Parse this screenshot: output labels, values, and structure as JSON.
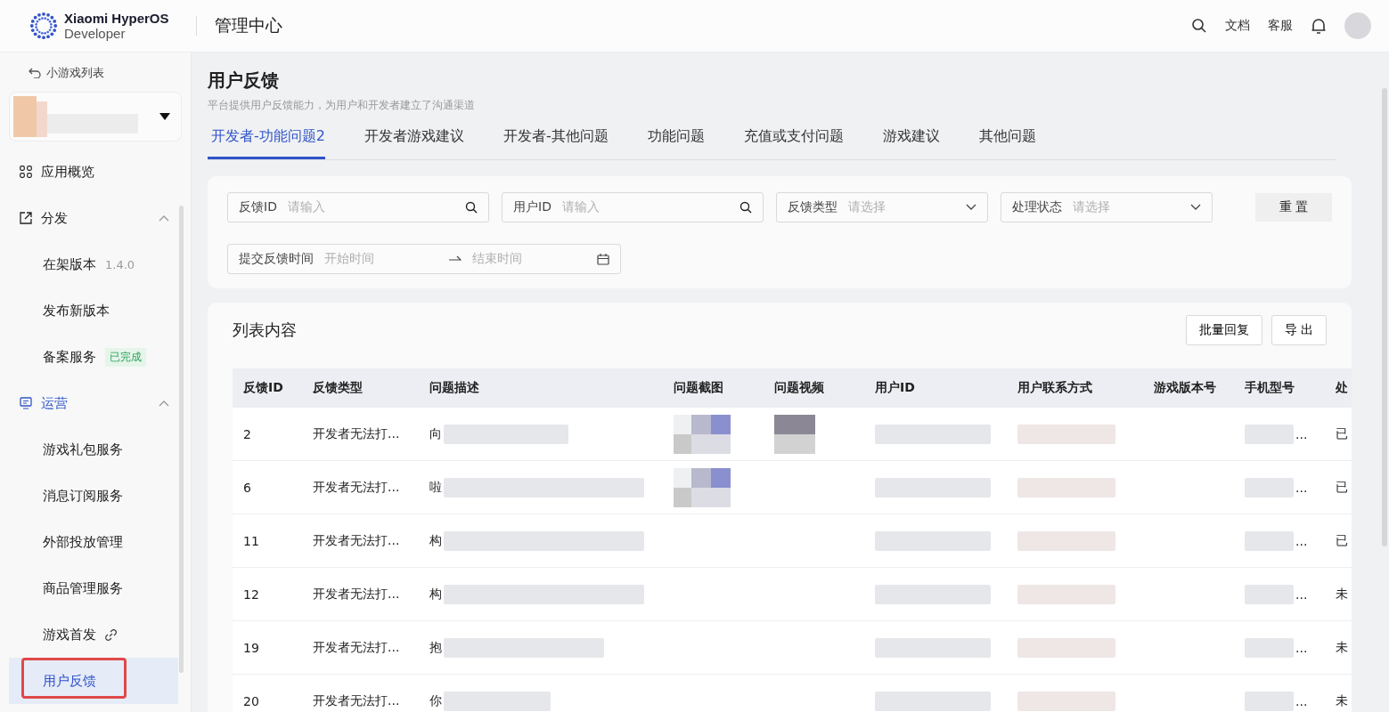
{
  "header": {
    "brand_name": "Xiaomi HyperOS",
    "brand_sub": "Developer",
    "title": "管理中心",
    "links": [
      "文档",
      "客服"
    ]
  },
  "sidebar": {
    "back": "小游戏列表",
    "app_redacted": true,
    "items": [
      {
        "label": "应用概览",
        "selected": false
      },
      {
        "label": "分发",
        "expanded": true,
        "selected": false,
        "children": [
          {
            "label": "在架版本",
            "version": "1.4.0",
            "selected": false
          },
          {
            "label": "发布新版本",
            "selected": false
          },
          {
            "label": "备案服务",
            "badge": "已完成",
            "selected": false
          }
        ]
      },
      {
        "label": "运营",
        "expanded": true,
        "selected": true,
        "children": [
          {
            "label": "游戏礼包服务",
            "selected": false
          },
          {
            "label": "消息订阅服务",
            "selected": false
          },
          {
            "label": "外部投放管理",
            "selected": false
          },
          {
            "label": "商品管理服务",
            "selected": false
          },
          {
            "label": "游戏首发",
            "link": true,
            "selected": false
          },
          {
            "label": "用户反馈",
            "selected": true,
            "annotated": true
          }
        ]
      }
    ]
  },
  "page": {
    "title": "用户反馈",
    "subtitle": "平台提供用户反馈能力，为用户和开发者建立了沟通渠道"
  },
  "tabs": [
    {
      "label": "开发者-功能问题2",
      "selected": true
    },
    {
      "label": "开发者游戏建议",
      "selected": false
    },
    {
      "label": "开发者-其他问题",
      "selected": false
    },
    {
      "label": "功能问题",
      "selected": false
    },
    {
      "label": "充值或支付问题",
      "selected": false
    },
    {
      "label": "游戏建议",
      "selected": false
    },
    {
      "label": "其他问题",
      "selected": false
    }
  ],
  "filters": [
    {
      "kind": "search",
      "label": "反馈ID",
      "placeholder": "请输入"
    },
    {
      "kind": "search",
      "label": "用户ID",
      "placeholder": "请输入"
    },
    {
      "kind": "select",
      "label": "反馈类型",
      "placeholder": "请选择"
    },
    {
      "kind": "select",
      "label": "处理状态",
      "placeholder": "请选择"
    },
    {
      "kind": "daterange",
      "label": "提交反馈时间",
      "placeholder": "开始时间",
      "placeholder_end": "结束时间"
    }
  ],
  "reset_button": "重 置",
  "list": {
    "title": "列表内容",
    "buttons": [
      "批量回复",
      "导 出"
    ],
    "columns": [
      "反馈ID",
      "反馈类型",
      "问题描述",
      "问题截图",
      "问题视频",
      "用户ID",
      "用户联系方式",
      "游戏版本号",
      "手机型号",
      "处"
    ],
    "rows": [
      {
        "id": "2",
        "type": "开发者无法打...",
        "description": "向",
        "screenshot": true,
        "video": true,
        "phone": "...",
        "status": "已"
      },
      {
        "id": "6",
        "type": "开发者无法打...",
        "description": "啦",
        "screenshot": true,
        "video": false,
        "phone": "...",
        "status": "已"
      },
      {
        "id": "11",
        "type": "开发者无法打...",
        "description": "构",
        "screenshot": false,
        "video": false,
        "phone": "...",
        "status": "已"
      },
      {
        "id": "12",
        "type": "开发者无法打...",
        "description": "构",
        "screenshot": false,
        "video": false,
        "phone": "...",
        "status": "未"
      },
      {
        "id": "19",
        "type": "开发者无法打...",
        "description": "抱",
        "screenshot": false,
        "video": false,
        "phone": "...",
        "status": "未"
      },
      {
        "id": "20",
        "type": "开发者无法打...",
        "description": "你",
        "screenshot": false,
        "video": false,
        "phone": "...",
        "status": "未"
      }
    ]
  }
}
